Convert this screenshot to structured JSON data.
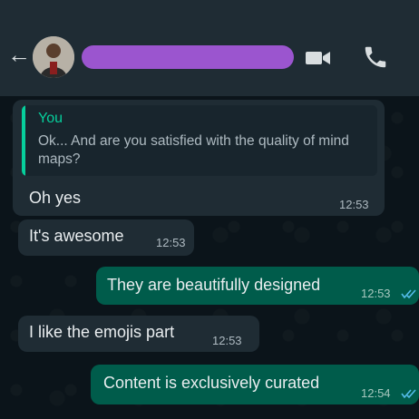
{
  "header": {
    "back_icon": "arrow-left-icon",
    "avatar_icon": "contact-avatar",
    "video_icon": "video-camera-icon",
    "call_icon": "phone-icon"
  },
  "colors": {
    "header_bg": "#1f2c34",
    "chat_bg": "#0b141a",
    "incoming_bubble": "#1f2c34",
    "outgoing_bubble": "#005c4b",
    "accent": "#06cf9c",
    "read_ticks": "#53bdeb",
    "redaction": "#9b55cf"
  },
  "messages": [
    {
      "direction": "incoming",
      "reply_to": {
        "author": "You",
        "text": "Ok... And are you satisfied with the quality of mind maps?"
      },
      "text": "Oh yes",
      "time": "12:53"
    },
    {
      "direction": "incoming",
      "text": "It's awesome",
      "time": "12:53"
    },
    {
      "direction": "outgoing",
      "text": "They are beautifully designed",
      "time": "12:53",
      "status": "read"
    },
    {
      "direction": "incoming",
      "text": "I like the emojis part",
      "time": "12:53"
    },
    {
      "direction": "outgoing",
      "text": "Content is exclusively curated",
      "time": "12:54",
      "status": "read"
    }
  ]
}
